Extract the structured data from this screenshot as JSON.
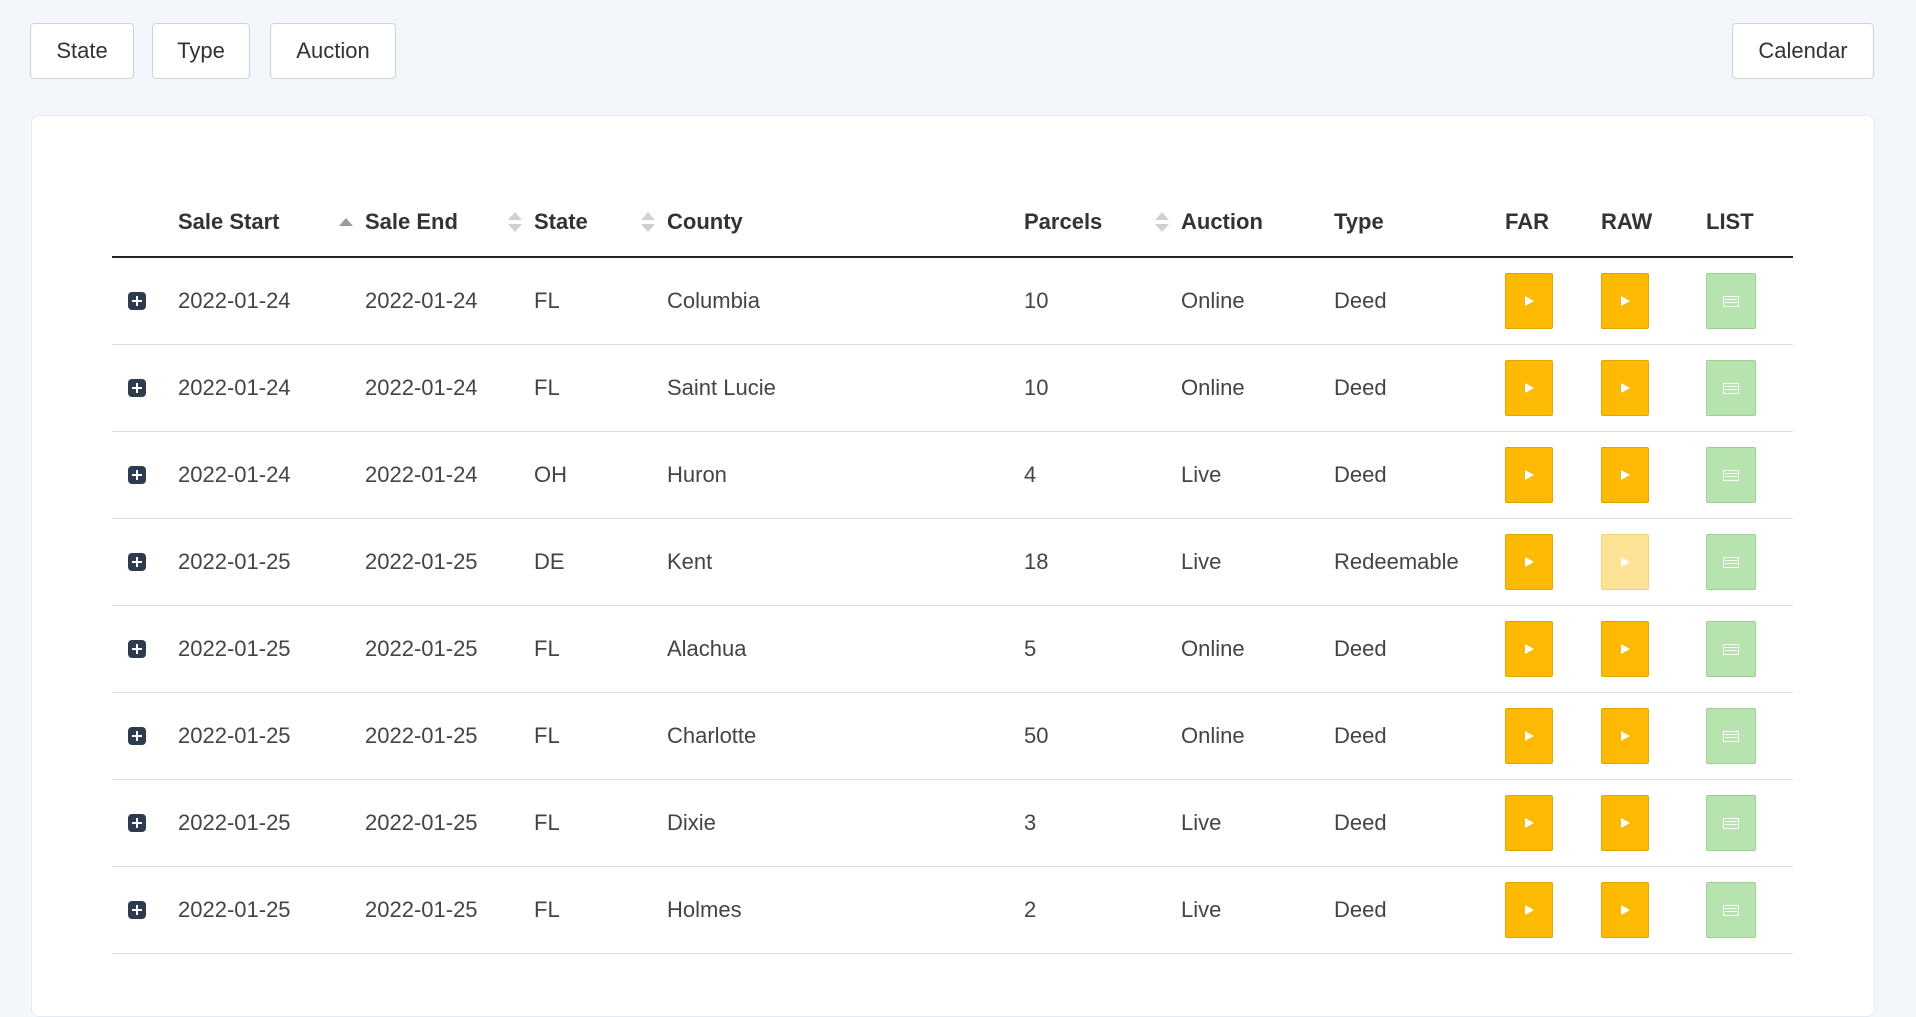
{
  "filters": {
    "state_label": "State",
    "type_label": "Type",
    "auction_label": "Auction",
    "calendar_label": "Calendar"
  },
  "table": {
    "headers": {
      "sale_start": "Sale Start",
      "sale_end": "Sale End",
      "state": "State",
      "county": "County",
      "parcels": "Parcels",
      "auction": "Auction",
      "type": "Type",
      "far": "FAR",
      "raw": "RAW",
      "list": "LIST"
    },
    "rows": [
      {
        "sale_start": "2022-01-24",
        "sale_end": "2022-01-24",
        "state": "FL",
        "county": "Columbia",
        "parcels": "10",
        "auction": "Online",
        "type": "Deed",
        "raw_enabled": true
      },
      {
        "sale_start": "2022-01-24",
        "sale_end": "2022-01-24",
        "state": "FL",
        "county": "Saint Lucie",
        "parcels": "10",
        "auction": "Online",
        "type": "Deed",
        "raw_enabled": true
      },
      {
        "sale_start": "2022-01-24",
        "sale_end": "2022-01-24",
        "state": "OH",
        "county": "Huron",
        "parcels": "4",
        "auction": "Live",
        "type": "Deed",
        "raw_enabled": true
      },
      {
        "sale_start": "2022-01-25",
        "sale_end": "2022-01-25",
        "state": "DE",
        "county": "Kent",
        "parcels": "18",
        "auction": "Live",
        "type": "Redeemable",
        "raw_enabled": false
      },
      {
        "sale_start": "2022-01-25",
        "sale_end": "2022-01-25",
        "state": "FL",
        "county": "Alachua",
        "parcels": "5",
        "auction": "Online",
        "type": "Deed",
        "raw_enabled": true
      },
      {
        "sale_start": "2022-01-25",
        "sale_end": "2022-01-25",
        "state": "FL",
        "county": "Charlotte",
        "parcels": "50",
        "auction": "Online",
        "type": "Deed",
        "raw_enabled": true
      },
      {
        "sale_start": "2022-01-25",
        "sale_end": "2022-01-25",
        "state": "FL",
        "county": "Dixie",
        "parcels": "3",
        "auction": "Live",
        "type": "Deed",
        "raw_enabled": true
      },
      {
        "sale_start": "2022-01-25",
        "sale_end": "2022-01-25",
        "state": "FL",
        "county": "Holmes",
        "parcels": "2",
        "auction": "Live",
        "type": "Deed",
        "raw_enabled": true
      }
    ]
  },
  "icons": {
    "expand": "plus-square-icon",
    "far": "arrow-right-icon",
    "raw": "arrow-right-icon",
    "list": "list-icon"
  },
  "colors": {
    "far_button": "#fcba05",
    "raw_disabled": "#fde194",
    "list_button": "#b6e3ae",
    "page_bg": "#f3f7fc"
  }
}
